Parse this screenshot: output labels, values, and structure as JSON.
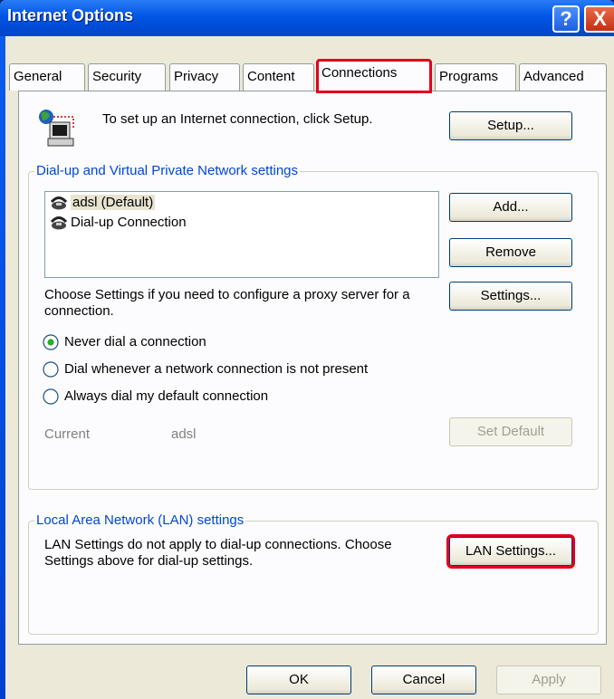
{
  "window": {
    "title": "Internet Options",
    "help_glyph": "?",
    "close_glyph": "X"
  },
  "tabs": [
    {
      "label": "General"
    },
    {
      "label": "Security"
    },
    {
      "label": "Privacy"
    },
    {
      "label": "Content"
    },
    {
      "label": "Connections"
    },
    {
      "label": "Programs"
    },
    {
      "label": "Advanced"
    }
  ],
  "setup": {
    "text": "To set up an Internet connection, click Setup.",
    "button": "Setup..."
  },
  "dialup": {
    "group_label": "Dial-up and Virtual Private Network settings",
    "connections": [
      {
        "label": "adsl (Default)"
      },
      {
        "label": "Dial-up Connection"
      }
    ],
    "add_button": "Add...",
    "remove_button": "Remove",
    "proxy_text": "Choose Settings if you need to configure a proxy server for a connection.",
    "settings_button": "Settings...",
    "options": [
      {
        "label": "Never dial a connection"
      },
      {
        "label": "Dial whenever a network connection is not present"
      },
      {
        "label": "Always dial my default connection"
      }
    ],
    "current_label": "Current",
    "current_value": "adsl",
    "set_default_button": "Set Default"
  },
  "lan": {
    "group_label": "Local Area Network (LAN) settings",
    "text": "LAN Settings do not apply to dial-up connections. Choose Settings above for dial-up settings.",
    "button": "LAN Settings..."
  },
  "footer": {
    "ok": "OK",
    "cancel": "Cancel",
    "apply": "Apply"
  }
}
